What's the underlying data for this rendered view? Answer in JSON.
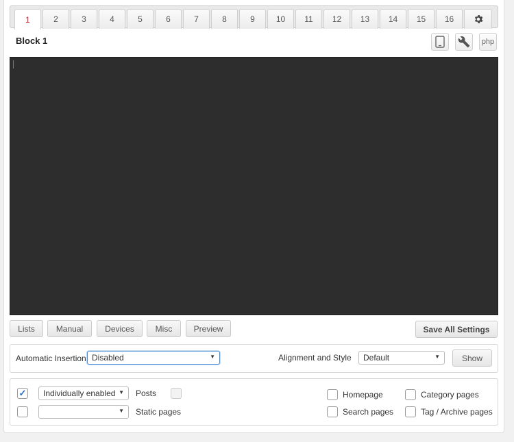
{
  "tabs": [
    "1",
    "2",
    "3",
    "4",
    "5",
    "6",
    "7",
    "8",
    "9",
    "10",
    "11",
    "12",
    "13",
    "14",
    "15",
    "16"
  ],
  "active_tab": "1",
  "block_title": "Block 1",
  "toolbar": {
    "php_label": "php"
  },
  "bottom_buttons": {
    "lists": "Lists",
    "manual": "Manual",
    "devices": "Devices",
    "misc": "Misc",
    "preview": "Preview",
    "save_all": "Save All Settings"
  },
  "insertion": {
    "label": "Automatic Insertion",
    "value": "Disabled",
    "alignment_label": "Alignment and Style",
    "alignment_value": "Default",
    "show_button": "Show"
  },
  "filters": {
    "posts_select": "Individually enabled",
    "posts_label": "Posts",
    "posts_checked": true,
    "static_select": "",
    "static_label": "Static pages",
    "homepage": "Homepage",
    "category_pages": "Category pages",
    "search_pages": "Search pages",
    "tag_archive_pages": "Tag / Archive pages"
  },
  "colors": {
    "active_tab": "#d0202a",
    "editor_bg": "#2d2d2d",
    "check_accent": "#2b6cc4"
  },
  "icons": {
    "gear": "gear-icon",
    "device": "tablet-icon",
    "wrench": "wrench-icon"
  }
}
